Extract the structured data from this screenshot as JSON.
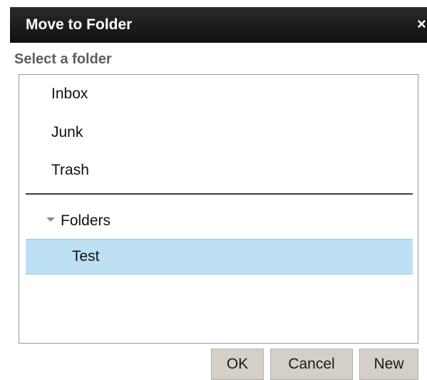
{
  "dialog": {
    "title": "Move to Folder",
    "close_glyph": "×",
    "subtitle": "Select a folder"
  },
  "system_folders": [
    {
      "label": "Inbox",
      "icon": "none"
    },
    {
      "label": "Junk",
      "icon": "none"
    },
    {
      "label": "Trash",
      "icon": "none"
    }
  ],
  "folders_group": {
    "label": "Folders",
    "expanded": true,
    "toggle_icon": "triangle-down-icon",
    "items": [
      {
        "label": "Test",
        "selected": true
      }
    ]
  },
  "buttons": {
    "ok": "OK",
    "cancel": "Cancel",
    "new": "New"
  },
  "colors": {
    "titlebar": "#111111",
    "selection": "#bde0f3",
    "button": "#d4d0c8",
    "subtitle": "#5d5d5d"
  }
}
